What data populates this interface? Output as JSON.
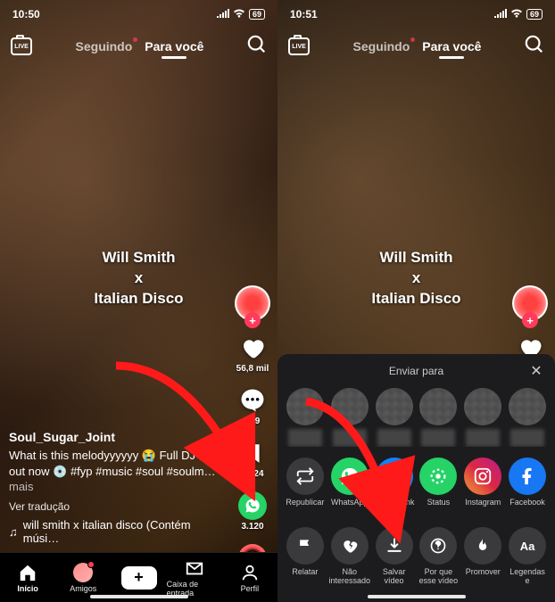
{
  "left": {
    "status": {
      "time": "10:50",
      "battery": "69"
    },
    "tabs": {
      "following": "Seguindo",
      "foryou": "Para você"
    },
    "overlay": "Will Smith\nx\nItalian Disco",
    "rail": {
      "likes": "56,8 mil",
      "comments": "319",
      "saves": "9.524",
      "shares": "3.120"
    },
    "author": "Soul_Sugar_Joint",
    "caption_prefix": "What is this melodyyyyyy 😭 Full DJ set out now 💿 ",
    "caption_tags": "#fyp #music #soul #soulm…",
    "caption_more": " mais",
    "translate": "Ver tradução",
    "music": "will smith x italian disco (Contém músi…",
    "nav": {
      "home": "Início",
      "friends": "Amigos",
      "inbox": "Caixa de entrada",
      "profile": "Perfil"
    }
  },
  "right": {
    "status": {
      "time": "10:51",
      "battery": "69"
    },
    "tabs": {
      "following": "Seguindo",
      "foryou": "Para você"
    },
    "overlay": "Will Smith\nx\nItalian Disco",
    "sheet_title": "Enviar para",
    "share_row1": {
      "repost": "Republicar",
      "whatsapp": "WhatsApp",
      "copy": "Copiar Link",
      "status": "Status",
      "instagram": "Instagram",
      "facebook": "Facebook"
    },
    "share_row2": {
      "report": "Relatar",
      "notint": "Não\ninteressado",
      "save": "Salvar vídeo",
      "why": "Por que\nesse vídeo",
      "promote": "Promover",
      "captions": "Legendas\ne traduções"
    }
  }
}
